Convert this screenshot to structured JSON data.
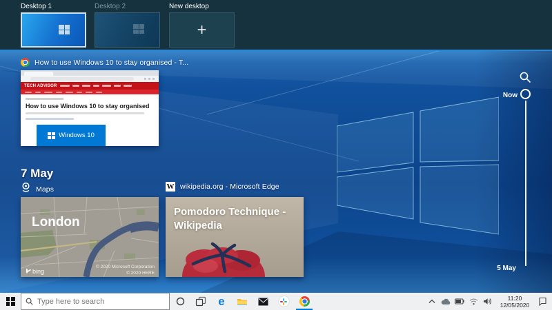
{
  "desktops": {
    "items": [
      {
        "label": "Desktop 1"
      },
      {
        "label": "Desktop 2"
      },
      {
        "label": "New desktop",
        "plus": "+"
      }
    ]
  },
  "current_window": {
    "app_icon": "chrome",
    "title": "How to use Windows 10 to stay organised - T...",
    "page": {
      "brand": "TECH ADVISOR",
      "heading": "How to use Windows 10 to stay organised",
      "promo_label": "Windows 10"
    }
  },
  "timeline": {
    "date_header": "7 May",
    "maps_group": {
      "app_label": "Maps",
      "card_title": "London",
      "bing_label": "bing",
      "attribution_line1": "© 2020 Microsoft Corporation",
      "attribution_line2": "© 2020 HERE"
    },
    "edge_group": {
      "app_label": "wikipedia.org - Microsoft Edge",
      "wiki_glyph": "W",
      "card_title": "Pomodoro Technique - Wikipedia"
    },
    "scrubber": {
      "now_label": "Now",
      "end_label": "5 May"
    }
  },
  "taskbar": {
    "search_placeholder": "Type here to search",
    "clock_time": "11:20",
    "clock_date": "12/05/2020"
  },
  "colors": {
    "accent_blue": "#0078d7",
    "wallpaper_blue": "#0d4a94",
    "topstrip_bg": "#16323e",
    "taskbar_bg": "#eef0f1",
    "techadvisor_red": "#c41219",
    "map_river": "#4e648a",
    "wiki_card_bg": "#b3aa9c",
    "tomato_red": "#b52b3a"
  }
}
